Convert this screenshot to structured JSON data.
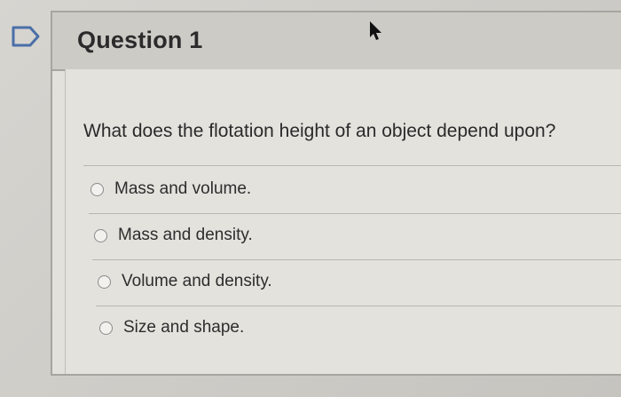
{
  "question": {
    "title": "Question 1",
    "prompt": "What does the flotation height of an object depend upon?",
    "options": [
      {
        "label": "Mass and volume."
      },
      {
        "label": "Mass and density."
      },
      {
        "label": "Volume and density."
      },
      {
        "label": "Size and shape."
      }
    ]
  },
  "icons": {
    "flag": "flag-outline-icon",
    "cursor": "mouse-pointer-icon"
  },
  "colors": {
    "header_bg": "#cdcbc6",
    "panel_bg": "#e3e1dc",
    "flag_stroke": "#4a6fa8"
  }
}
